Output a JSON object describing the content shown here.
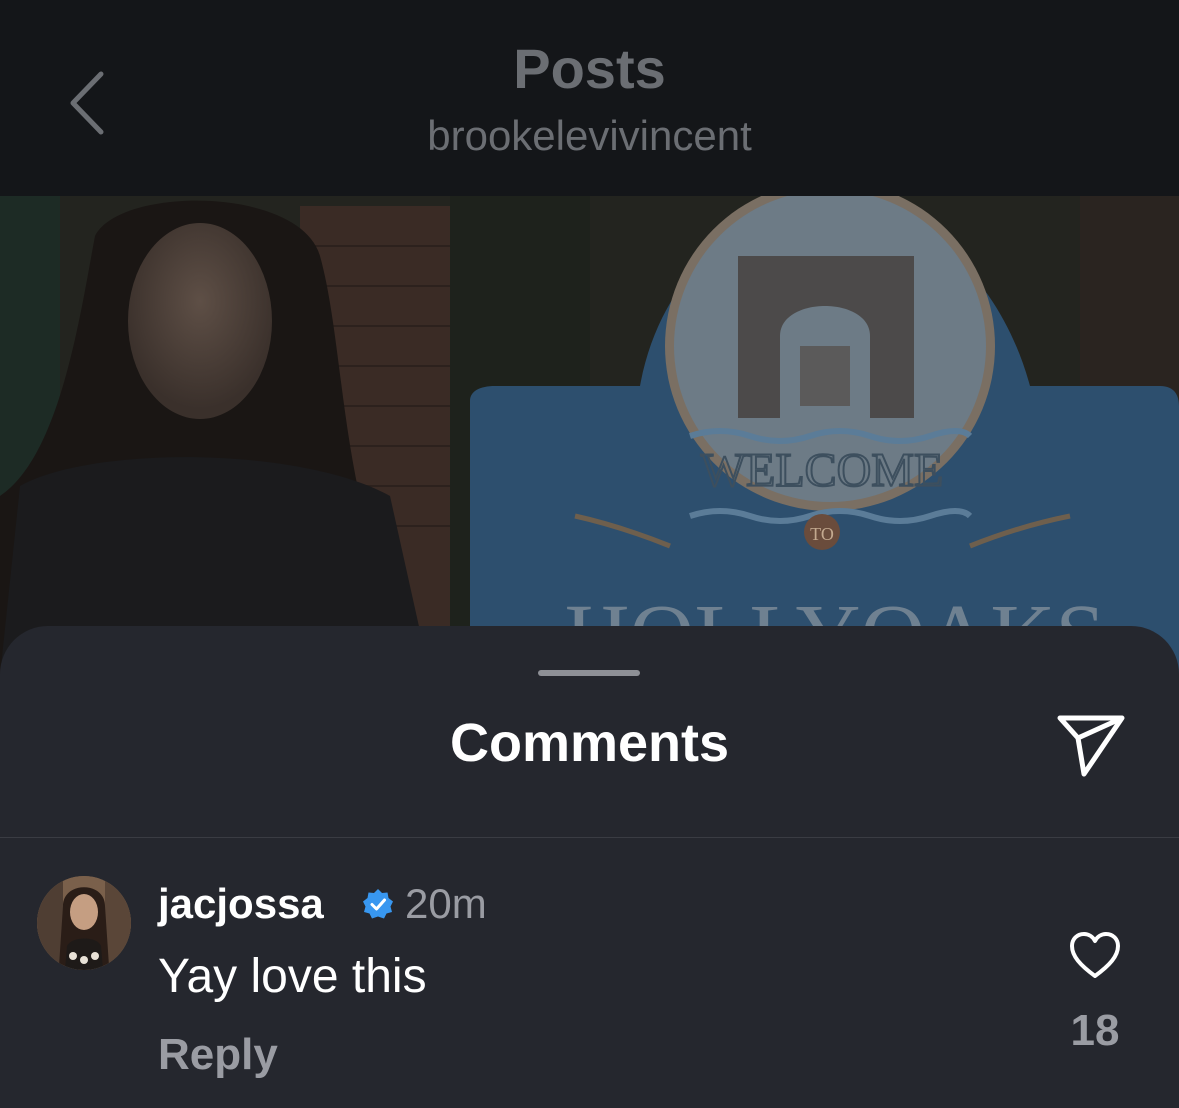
{
  "header": {
    "title": "Posts",
    "subtitle": "brookelevivincent",
    "back_icon": "chevron-left-icon"
  },
  "post": {
    "sign_text_top": "WELCOME",
    "sign_text_mid": "TO",
    "sign_text_bottom": "HOLLYOAKS"
  },
  "comments_sheet": {
    "title": "Comments",
    "share_icon": "send-icon",
    "comments": [
      {
        "username": "jacjossa",
        "verified": true,
        "timestamp": "20m",
        "text": "Yay love this",
        "reply_label": "Reply",
        "like_icon": "heart-icon",
        "like_count": "18"
      }
    ]
  },
  "colors": {
    "header_bg": "#141619",
    "sheet_bg": "#25272e",
    "muted_text": "#9a9ca3",
    "verified_blue": "#3897f0"
  }
}
